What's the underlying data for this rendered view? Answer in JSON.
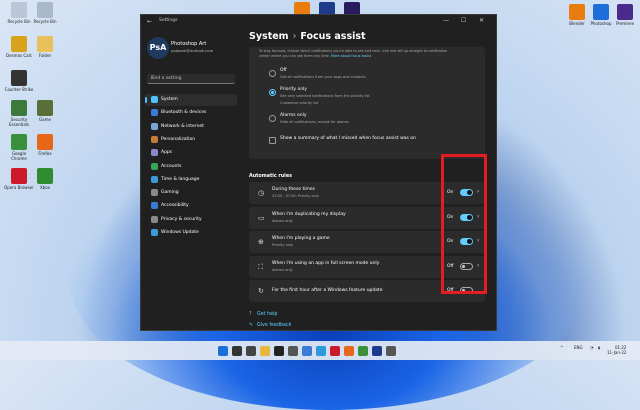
{
  "desktop": {
    "left_icons": [
      {
        "label": "Recycle Bin",
        "icon": "recycle-bin-icon",
        "color": "#b9c7d8"
      },
      {
        "label": "Recycle Bin",
        "icon": "recycle-bin-icon",
        "color": "#aab8cc"
      },
      {
        "label": "Desmos Calc",
        "icon": "app-icon",
        "color": "#d8a31a"
      },
      {
        "label": "Folder",
        "icon": "folder-icon",
        "color": "#e8c15a"
      },
      {
        "label": "Counter-Strike",
        "icon": "game-icon",
        "color": "#333333"
      },
      {
        "label": "Game",
        "icon": "game-icon",
        "color": "#5a6e3a"
      },
      {
        "label": "Security Essentials",
        "icon": "shield-icon",
        "color": "#3b7a3b"
      },
      {
        "label": "Google Chrome",
        "icon": "chrome-icon",
        "color": "#3a8f3a"
      },
      {
        "label": "Firefox",
        "icon": "firefox-icon",
        "color": "#e8661a"
      },
      {
        "label": "Opera Browser",
        "icon": "opera-icon",
        "color": "#cc1a2a"
      },
      {
        "label": "Xbox",
        "icon": "xbox-icon",
        "color": "#2e8b2e"
      }
    ],
    "top_icons": [
      {
        "icon": "blender-icon",
        "color": "#e87d0d"
      },
      {
        "icon": "photoshop-icon",
        "color": "#1e3a8a"
      },
      {
        "icon": "premiere-icon",
        "color": "#2a1a5e"
      }
    ],
    "right_icons": [
      {
        "label": "Blender",
        "icon": "blender-icon",
        "color": "#e87d0d"
      },
      {
        "label": "Photoshop",
        "icon": "photoshop-icon",
        "color": "#1e6fd9"
      },
      {
        "label": "Premiere",
        "icon": "premiere-icon",
        "color": "#4a2a8a"
      }
    ]
  },
  "window": {
    "title": "Settings",
    "back_glyph": "←",
    "min_glyph": "—",
    "max_glyph": "☐",
    "close_glyph": "✕"
  },
  "user": {
    "initials": "PsA",
    "name": "Photoshop Art",
    "email": "pajepak@outlook.com"
  },
  "search": {
    "placeholder": "Find a setting"
  },
  "nav": [
    {
      "label": "System",
      "icon": "system-icon",
      "color": "#4cc2ff",
      "selected": true
    },
    {
      "label": "Bluetooth & devices",
      "icon": "bluetooth-icon",
      "color": "#3a7bd5"
    },
    {
      "label": "Network & internet",
      "icon": "network-icon",
      "color": "#7aa7d8"
    },
    {
      "label": "Personalization",
      "icon": "brush-icon",
      "color": "#c77b3a"
    },
    {
      "label": "Apps",
      "icon": "apps-icon",
      "color": "#8a8acb"
    },
    {
      "label": "Accounts",
      "icon": "accounts-icon",
      "color": "#3aa35a"
    },
    {
      "label": "Time & language",
      "icon": "clock-icon",
      "color": "#3a9bd5"
    },
    {
      "label": "Gaming",
      "icon": "gaming-icon",
      "color": "#8a8a8a"
    },
    {
      "label": "Accessibility",
      "icon": "accessibility-icon",
      "color": "#3a7bd5"
    },
    {
      "label": "Privacy & security",
      "icon": "shield-icon",
      "color": "#8a8a8a"
    },
    {
      "label": "Windows Update",
      "icon": "update-icon",
      "color": "#3a9bd5"
    }
  ],
  "breadcrumb": {
    "parent": "System",
    "separator": "›",
    "current": "Focus assist"
  },
  "focus": {
    "intro_line1": "To stay focused, choose which notifications you're able to see and hear—the rest will go straight to notification",
    "intro_line2": "center where you can see them any time.",
    "intro_link": "More about focus assist",
    "options": [
      {
        "label": "Off",
        "desc": "Get all notifications from your apps and contacts",
        "selected": false
      },
      {
        "label": "Priority only",
        "desc": "See only selected notifications from the priority list",
        "link": "Customize priority list",
        "selected": true
      },
      {
        "label": "Alarms only",
        "desc": "Hide all notifications, except for alarms",
        "selected": false
      }
    ],
    "summary_label": "Show a summary of what I missed when focus assist was on"
  },
  "automatic_rules": {
    "title": "Automatic rules",
    "rules": [
      {
        "title": "During these times",
        "subtitle": "23:00 - 07:00; Priority only",
        "state": "On",
        "on": true,
        "icon": "clock-icon",
        "glyph": "◷"
      },
      {
        "title": "When I'm duplicating my display",
        "subtitle": "Alarms only",
        "state": "On",
        "on": true,
        "icon": "monitor-icon",
        "glyph": "▭"
      },
      {
        "title": "When I'm playing a game",
        "subtitle": "Priority only",
        "state": "On",
        "on": true,
        "icon": "gamepad-icon",
        "glyph": "⊕"
      },
      {
        "title": "When I'm using an app in full screen mode only",
        "subtitle": "Alarms only",
        "state": "Off",
        "on": false,
        "icon": "fullscreen-icon",
        "glyph": "⛶"
      },
      {
        "title": "For the first hour after a Windows feature update",
        "subtitle": "",
        "state": "Off",
        "on": false,
        "icon": "update-icon",
        "glyph": "↻"
      }
    ]
  },
  "help": {
    "get_help": "Get help",
    "give_feedback": "Give feedback"
  },
  "annotation_color": "#e51c23",
  "taskbar": {
    "icons": [
      {
        "icon": "start-icon",
        "color": "#1a6fd9"
      },
      {
        "icon": "search-icon",
        "color": "#333333"
      },
      {
        "icon": "task-view-icon",
        "color": "#444444"
      },
      {
        "icon": "explorer-icon",
        "color": "#e8b83a"
      },
      {
        "icon": "terminal-icon",
        "color": "#222222"
      },
      {
        "icon": "counter-strike-icon",
        "color": "#555555"
      },
      {
        "icon": "store-icon",
        "color": "#3a7bd5"
      },
      {
        "icon": "edge-icon",
        "color": "#2a9ad8"
      },
      {
        "icon": "opera-icon",
        "color": "#cc1a2a"
      },
      {
        "icon": "firefox-icon",
        "color": "#e8661a"
      },
      {
        "icon": "chrome-icon",
        "color": "#3a8f3a"
      },
      {
        "icon": "photoshop-icon",
        "color": "#1e3a8a"
      },
      {
        "icon": "settings-icon",
        "color": "#555555"
      }
    ],
    "tray_chevron": "^",
    "language": "ENG",
    "time": "01:22",
    "date": "11-Jan-22"
  }
}
